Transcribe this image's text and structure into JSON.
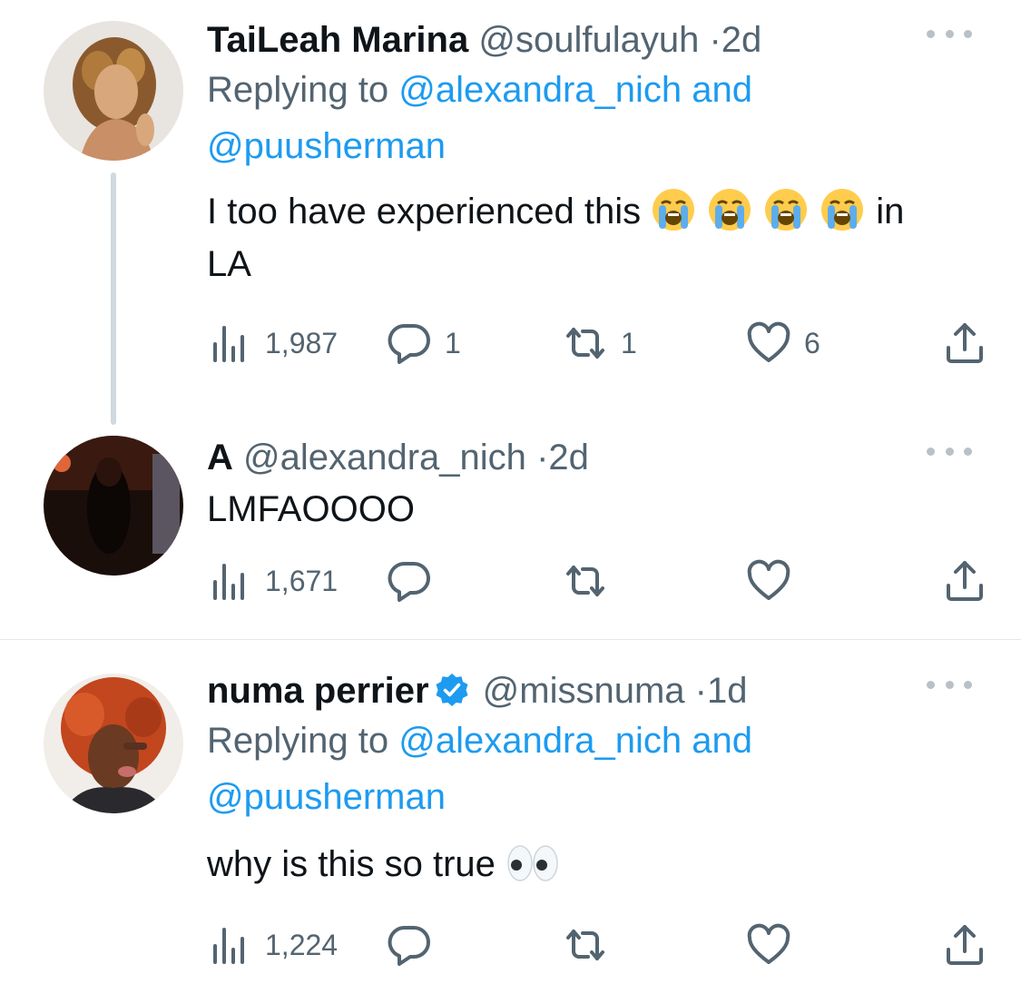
{
  "tweets": [
    {
      "name": "TaiLeah Marina",
      "handle": "@soulfulayuh",
      "dot": "·",
      "time": "2d",
      "replying_prefix": "Replying to ",
      "replying_user1": "@alexandra_nich",
      "replying_and": " and",
      "replying_user2": "@puusherman",
      "text_main": "I too have experienced this ",
      "text_after_emoji": "in",
      "text_line2": "LA",
      "emoji_icon": "loudly-crying-face",
      "views": "1,987",
      "replies": "1",
      "retweets": "1",
      "likes": "6"
    },
    {
      "name": "A",
      "handle": "@alexandra_nich",
      "dot": "·",
      "time": "2d",
      "text": "LMFAOOOO",
      "views": "1,671"
    },
    {
      "name": "numa perrier",
      "handle": "@missnuma",
      "dot": "·",
      "time": "1d",
      "verified": true,
      "replying_prefix": "Replying to ",
      "replying_user1": "@alexandra_nich",
      "replying_and": " and",
      "replying_user2": "@puusherman",
      "text": "why is this so true ",
      "emoji_icon": "eyes",
      "views": "1,224"
    }
  ],
  "colors": {
    "link": "#1d9bf0",
    "secondary": "#536471",
    "primary": "#0f1419",
    "thread_line": "#cfd9de"
  }
}
